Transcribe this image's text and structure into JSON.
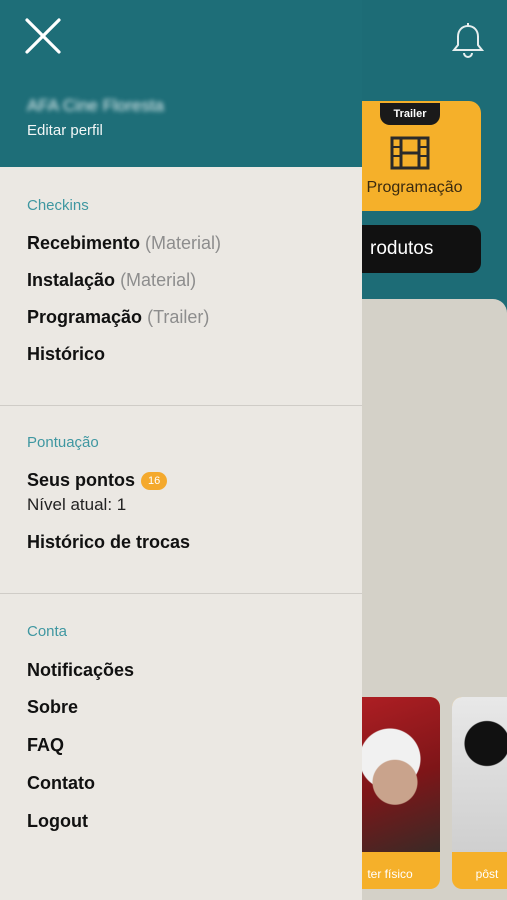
{
  "background": {
    "card_badge": "Trailer",
    "card_label": "Programação",
    "pill_label": "rodutos",
    "poster_captions": [
      "ter físico",
      "pôst"
    ]
  },
  "drawer": {
    "profile_name": "AFA Cine Floresta",
    "edit_profile": "Editar perfil",
    "checkins": {
      "title": "Checkins",
      "items": [
        {
          "label": "Recebimento",
          "sub": "(Material)"
        },
        {
          "label": "Instalação",
          "sub": "(Material)"
        },
        {
          "label": "Programação",
          "sub": "(Trailer)"
        },
        {
          "label": "Histórico",
          "sub": ""
        }
      ]
    },
    "pontuacao": {
      "title": "Pontuação",
      "points_label": "Seus pontos",
      "points_value": "16",
      "level_text": "Nível atual: 1",
      "history_label": "Histórico de trocas"
    },
    "conta": {
      "title": "Conta",
      "items": [
        "Notificações",
        "Sobre",
        "FAQ",
        "Contato",
        "Logout"
      ]
    }
  },
  "colors": {
    "header": "#1e6e78",
    "accent_text": "#3f97a1",
    "badge": "#f4a92d",
    "drawer_bg": "#ebe8e3"
  }
}
